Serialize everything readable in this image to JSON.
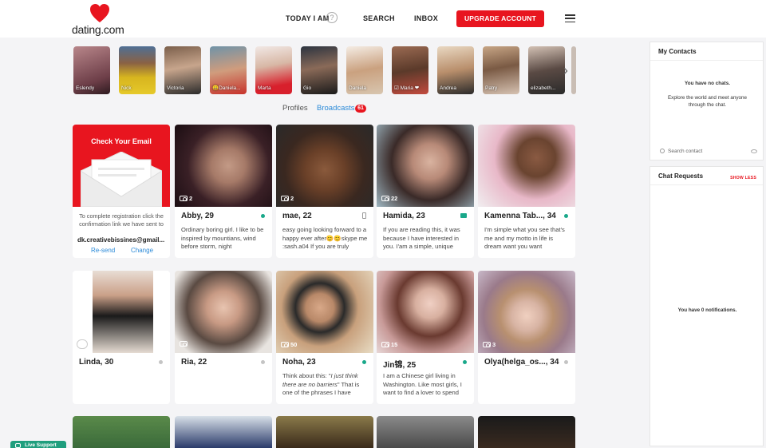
{
  "header": {
    "logo_text": "dating.com",
    "nav": [
      "TODAY I AM",
      "SEARCH",
      "INBOX"
    ],
    "help_glyph": "?",
    "upgrade_label": "UPGRADE ACCOUNT",
    "menu_icon": "hamburger-icon"
  },
  "stories": [
    {
      "name": "Eslendy"
    },
    {
      "name": "Nick"
    },
    {
      "name": "Victoria"
    },
    {
      "name": "😀Daniela..."
    },
    {
      "name": "Marta"
    },
    {
      "name": "Gio"
    },
    {
      "name": "Daniela"
    },
    {
      "name": "☑ Maria ❤"
    },
    {
      "name": "Andrea"
    },
    {
      "name": "Patry"
    },
    {
      "name": "elizabeth..."
    }
  ],
  "tabs": {
    "profiles": "Profiles",
    "broadcasts": "Broadcasts",
    "broadcasts_count": "61"
  },
  "email_card": {
    "title": "Check Your Email",
    "text": "To complete registration click the confirmation link we have sent to",
    "address": "dk.creativebissines@gmail...",
    "resend": "Re-send",
    "change": "Change"
  },
  "cards_row1": [
    {
      "name": "Abby, 29",
      "photo_count": "2",
      "status": "online",
      "bio": "Ordinary boring girl. I like to be inspired by mountians, wind before storm, night"
    },
    {
      "name": "mae, 22",
      "photo_count": "2",
      "status": "mobile",
      "bio": "easy going looking forward to a happy ever after😊😊skype me :sash.a04 If you are truly"
    },
    {
      "name": "Hamida, 23",
      "photo_count": "22",
      "status": "video",
      "bio": "If you are reading this, it was because I have interested in you. I'am a simple, unique"
    },
    {
      "name": "Kamenna Tab..., 34",
      "photo_count": "",
      "status": "online",
      "bio": "I'm simple what you see that's me and my motto in life is dream want you want"
    }
  ],
  "cards_row2": [
    {
      "name": "Linda, 30",
      "photo_count": "",
      "status": "offline",
      "bio": ""
    },
    {
      "name": "Ria, 22",
      "photo_count": "",
      "status": "offline",
      "bio": ""
    },
    {
      "name": "Noha, 23",
      "photo_count": "50",
      "status": "online",
      "bio_pre": "Think about this: \"",
      "bio_italic": "I just think there are no barriers",
      "bio_post": "\" That is one of the phrases I have"
    },
    {
      "name": "Jin锦, 25",
      "photo_count": "15",
      "status": "online",
      "bio": "I am a Chinese girl living in Washington. Like most girls, I want to find a lover to spend"
    },
    {
      "name": "Olya(helga_os..., 34",
      "photo_count": "3",
      "status": "offline",
      "bio": ""
    }
  ],
  "sidebar": {
    "contacts_title": "My Contacts",
    "no_chats": "You have no chats.",
    "explore": "Explore the world and meet anyone through the chat.",
    "search_placeholder": "Search contact",
    "requests_title": "Chat Requests",
    "show_less": "SHOW LESS",
    "no_notifications": "You have 0 notifications."
  },
  "live_support": "Live Support",
  "colors": {
    "brand": "#e8151f",
    "link": "#2b8ad8",
    "online": "#19a88a",
    "offline": "#c4c4c4"
  }
}
